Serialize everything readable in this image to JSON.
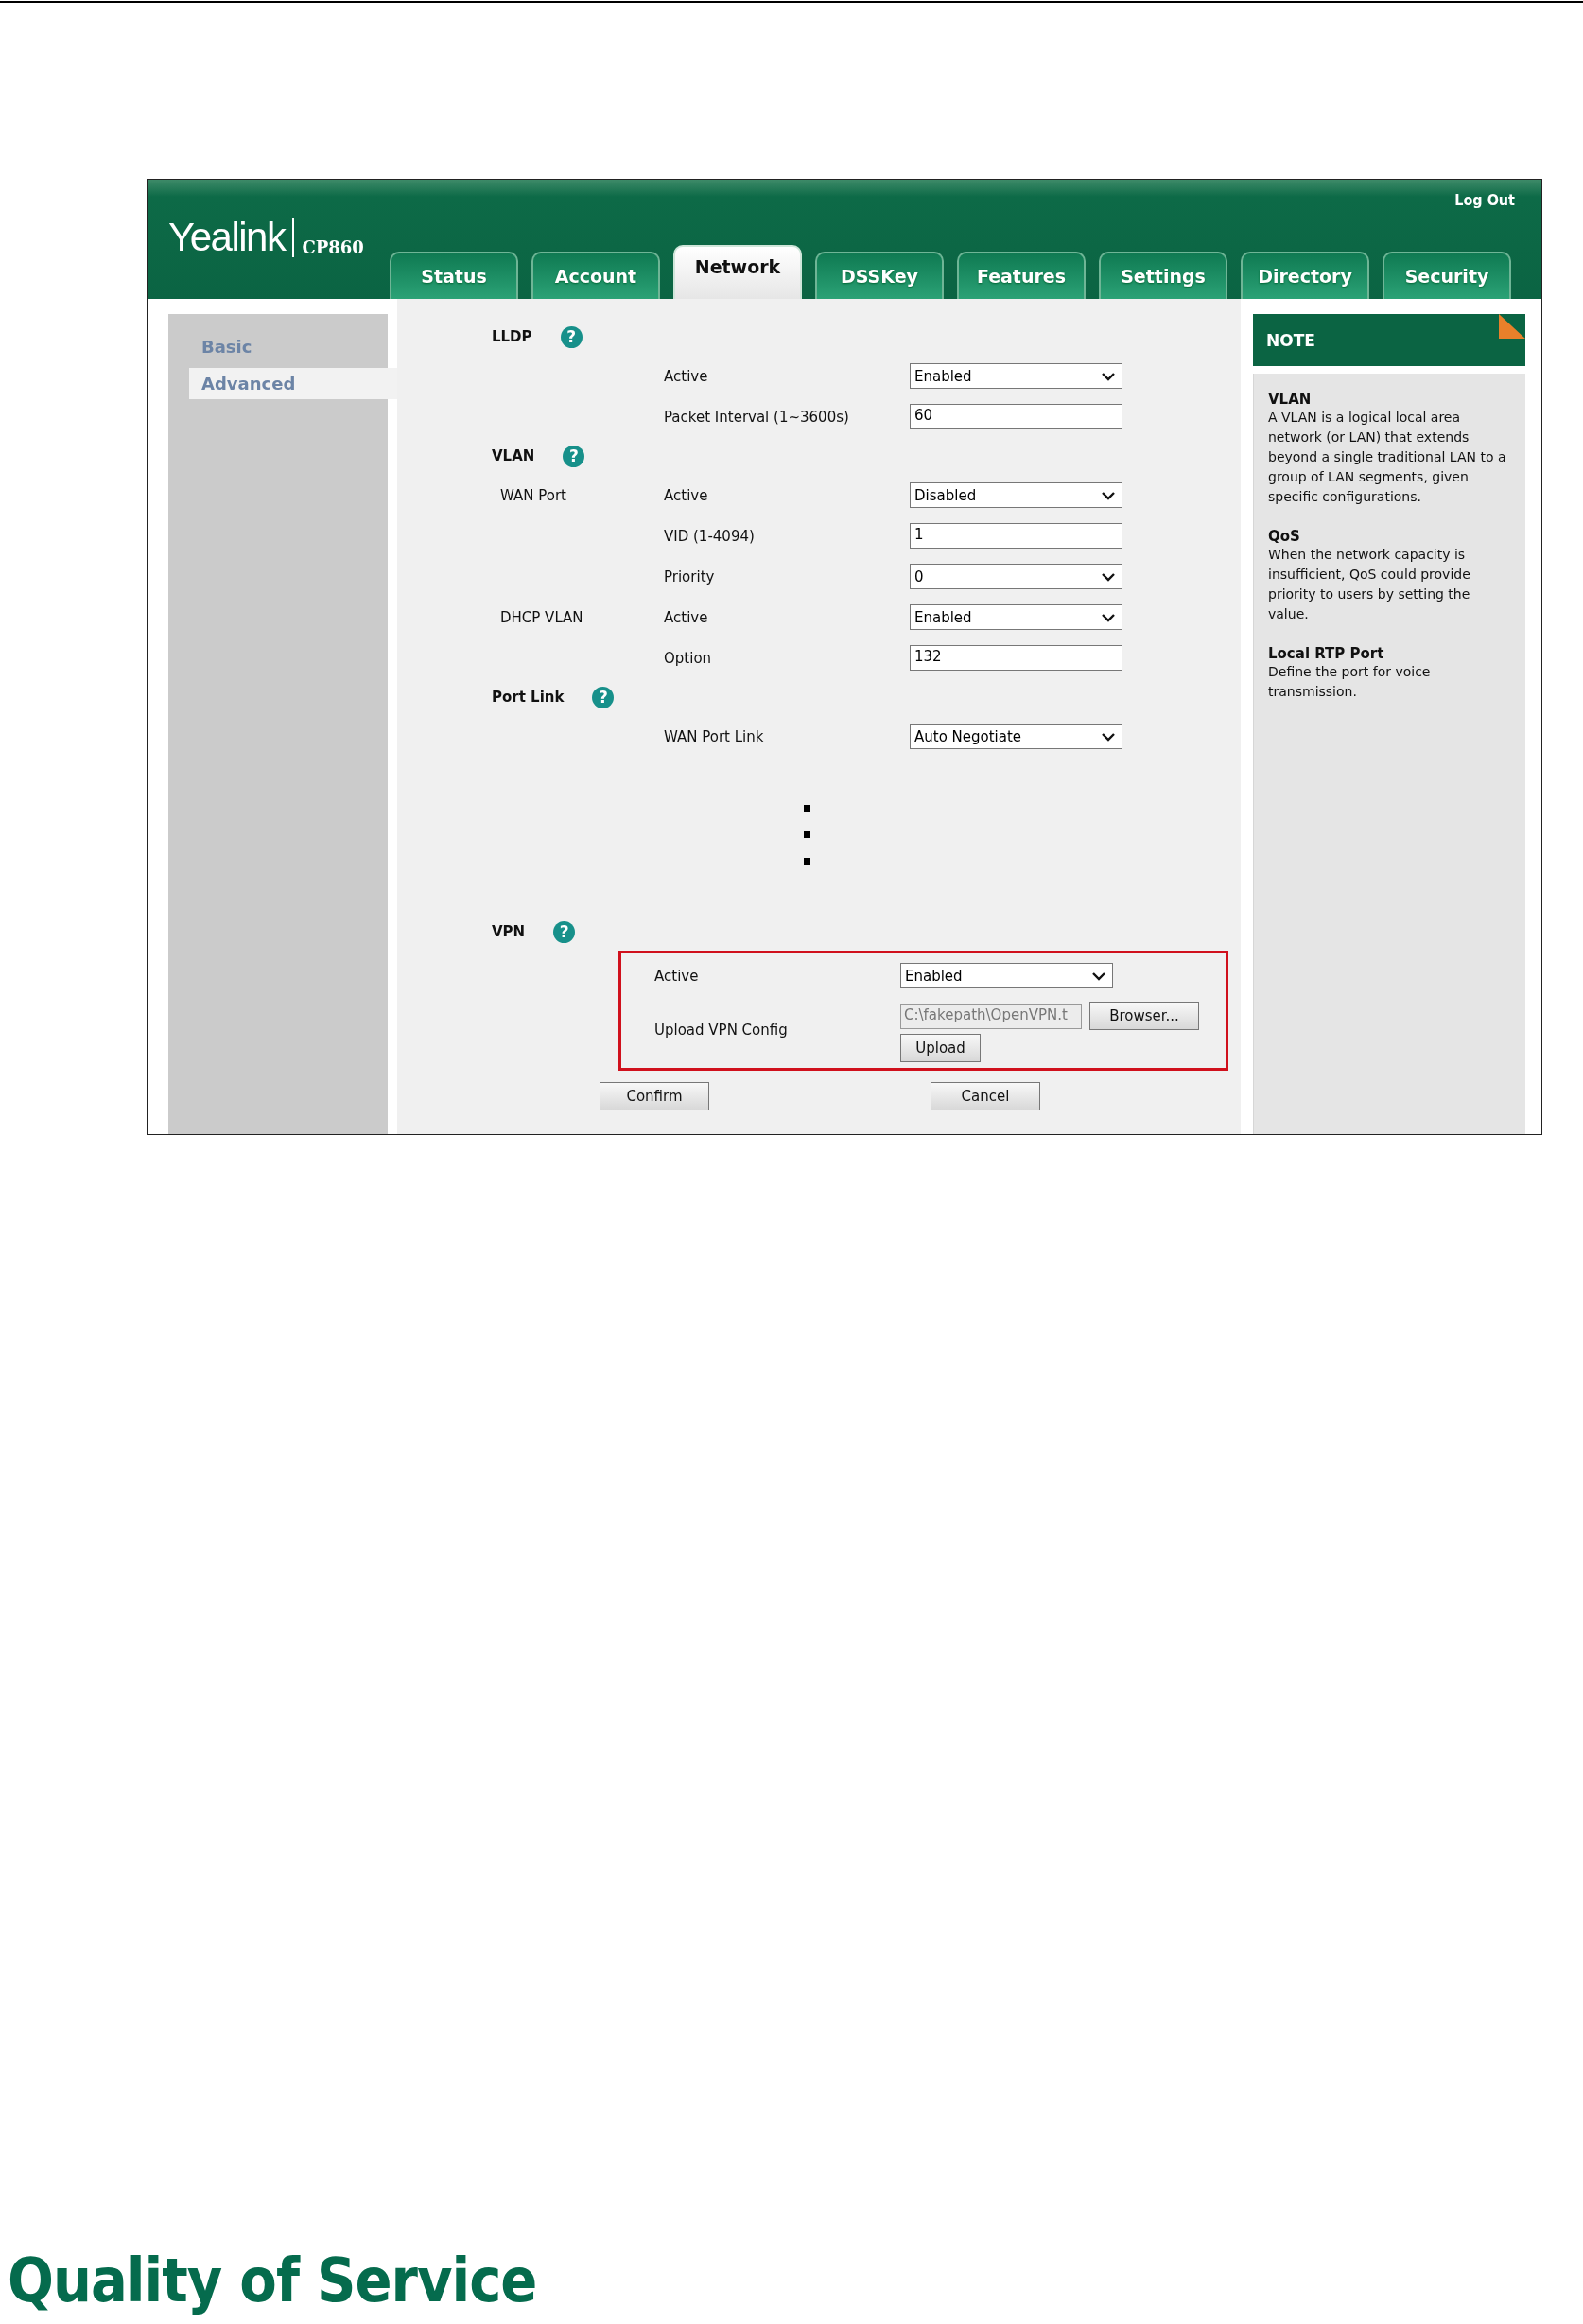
{
  "header": {
    "logo": "Yealink",
    "model": "CP860",
    "logout": "Log Out"
  },
  "tabs": [
    {
      "label": "Status",
      "selected": false
    },
    {
      "label": "Account",
      "selected": false
    },
    {
      "label": "Network",
      "selected": true
    },
    {
      "label": "DSSKey",
      "selected": false
    },
    {
      "label": "Features",
      "selected": false
    },
    {
      "label": "Settings",
      "selected": false
    },
    {
      "label": "Directory",
      "selected": false
    },
    {
      "label": "Security",
      "selected": false
    }
  ],
  "sidebar": {
    "items": [
      {
        "label": "Basic",
        "selected": false
      },
      {
        "label": "Advanced",
        "selected": true
      }
    ]
  },
  "sections": [
    {
      "kind": "settings",
      "title": "LLDP",
      "help": "?",
      "highlighted": false,
      "rows": [
        {
          "kind": "select",
          "label": "Active",
          "value": "Enabled"
        },
        {
          "kind": "text",
          "label": "Packet Interval (1~3600s)",
          "value": "60"
        }
      ]
    },
    {
      "kind": "settings",
      "title": "VLAN",
      "help": "?",
      "highlighted": false,
      "rows": [
        {
          "kind": "select",
          "group": "WAN Port",
          "label": "Active",
          "value": "Disabled"
        },
        {
          "kind": "text",
          "label": "VID (1-4094)",
          "value": "1"
        },
        {
          "kind": "select",
          "label": "Priority",
          "value": "0"
        },
        {
          "kind": "select",
          "group": "DHCP VLAN",
          "label": "Active",
          "value": "Enabled"
        },
        {
          "kind": "text",
          "label": "Option",
          "value": "132"
        }
      ]
    },
    {
      "kind": "settings",
      "title": "Port Link",
      "help": "?",
      "highlighted": false,
      "rows": [
        {
          "kind": "select",
          "label": "WAN Port Link",
          "value": "Auto Negotiate"
        }
      ]
    },
    {
      "kind": "omitted"
    },
    {
      "kind": "settings",
      "title": "VPN",
      "help": "?",
      "highlighted": true,
      "rows": [
        {
          "kind": "select",
          "label": "Active",
          "value": "Enabled"
        },
        {
          "kind": "file",
          "label": "Upload VPN Config",
          "value": "C:\\fakepath\\OpenVPN.t",
          "browse": "Browser...",
          "upload": "Upload"
        }
      ]
    }
  ],
  "buttons": [
    "Confirm",
    "Cancel"
  ],
  "note": {
    "title": "NOTE",
    "entries": [
      {
        "title": "VLAN",
        "text": "A VLAN is a logical local area network (or LAN) that extends beyond a single traditional LAN to a group of LAN segments, given specific configurations."
      },
      {
        "title": "QoS",
        "text": "When the network capacity is insufficient, QoS could provide priority to users by setting the value."
      },
      {
        "title": "Local RTP Port",
        "text": "Define the port for voice transmission."
      }
    ]
  },
  "page_heading": "Quality of Service"
}
